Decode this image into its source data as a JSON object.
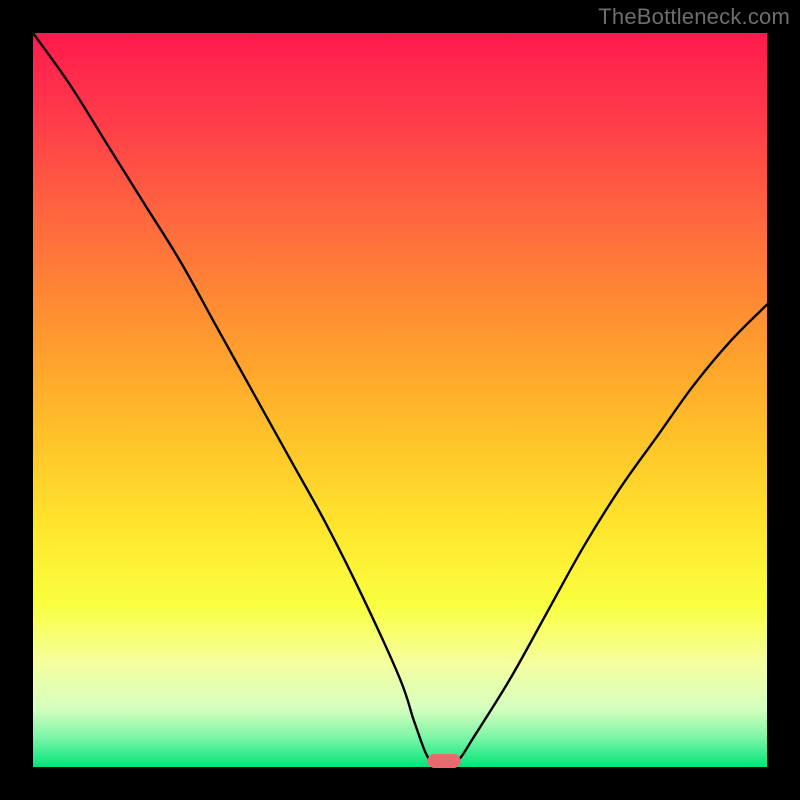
{
  "watermark": "TheBottleneck.com",
  "chart_data": {
    "type": "line",
    "title": "",
    "xlabel": "",
    "ylabel": "",
    "xlim": [
      0,
      100
    ],
    "ylim": [
      0,
      100
    ],
    "grid": false,
    "legend": false,
    "series": [
      {
        "name": "bottleneck-curve",
        "x": [
          0,
          5,
          10,
          15,
          20,
          25,
          30,
          35,
          40,
          45,
          50,
          52,
          54,
          56,
          58,
          60,
          65,
          70,
          75,
          80,
          85,
          90,
          95,
          100
        ],
        "y": [
          100,
          93,
          85,
          77,
          69,
          60,
          51,
          42,
          33,
          23,
          12,
          6,
          1,
          0,
          1,
          4,
          12,
          21,
          30,
          38,
          45,
          52,
          58,
          63
        ]
      }
    ],
    "marker": {
      "name": "optimal-marker",
      "x": 56,
      "width_pct": 4.5,
      "color": "#e86a6f"
    },
    "colors": {
      "curve": "#000000",
      "marker": "#e86a6f",
      "gradient_top": "#ff1a4d",
      "gradient_bottom": "#00e57a",
      "frame": "#000000"
    }
  }
}
